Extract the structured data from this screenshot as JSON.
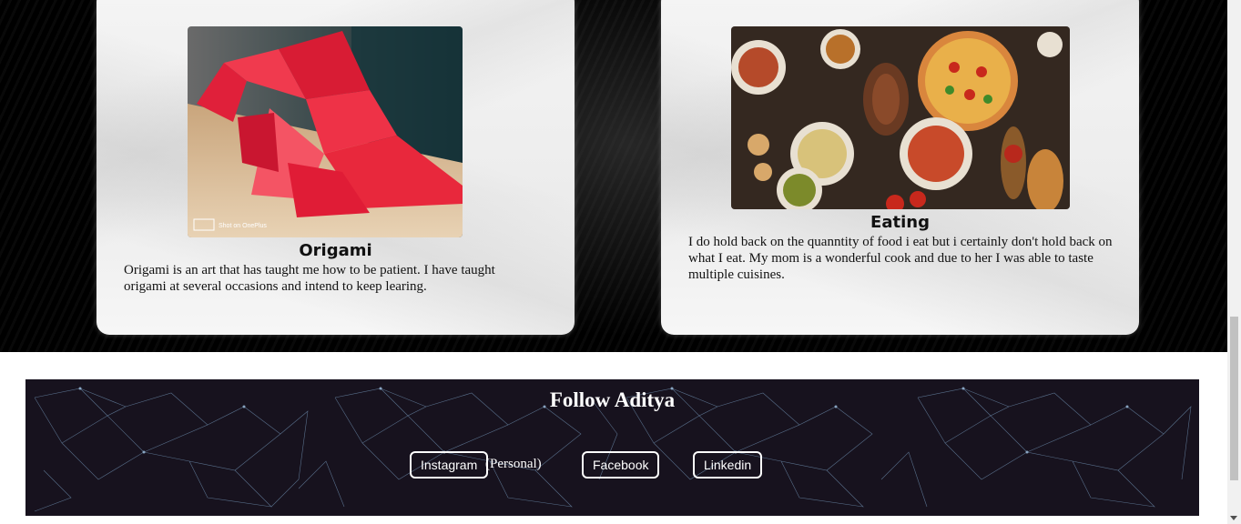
{
  "cards": [
    {
      "title": "Origami",
      "text": "Origami is an art that has taught me how to be patient. I have taught origami at several occasions and intend to keep learing.",
      "watermark": "Shot on OnePlus"
    },
    {
      "title": "Eating",
      "text": "I do hold back on the quanntity of food i eat but i certainly don't hold back on what I eat. My mom is a wonderful cook and due to her I was able to taste multiple cuisines."
    }
  ],
  "footer": {
    "title": "Follow Aditya",
    "instagram_label": "Instagram",
    "instagram_note": "(Personal)",
    "facebook_label": "Facebook",
    "linkedin_label": "Linkedin"
  },
  "colors": {
    "footer_bg": "#17121e",
    "origami_red": "#e8283c"
  }
}
